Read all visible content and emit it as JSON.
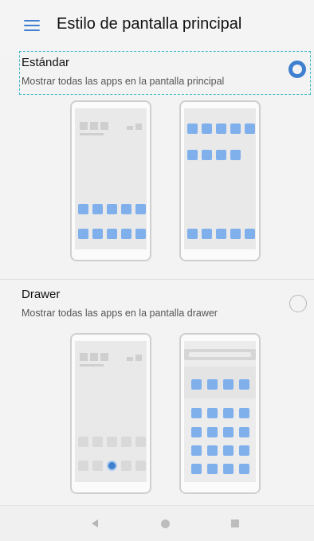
{
  "header": {
    "title": "Estilo de pantalla principal",
    "menu_icon": "hamburger-menu-icon"
  },
  "options": [
    {
      "title": "Estándar",
      "description": "Mostrar todas las apps en la pantalla principal",
      "selected": true
    },
    {
      "title": "Drawer",
      "description": "Mostrar todas las apps en la pantalla drawer",
      "selected": false
    }
  ],
  "navbar": {
    "icons": [
      "back-triangle-icon",
      "home-circle-icon",
      "recents-square-icon"
    ]
  },
  "colors": {
    "accent": "#3f7fd0",
    "focus_outline": "#38b8c8",
    "app_icon": "#7fb0ec",
    "background": "#f3f3f3"
  }
}
